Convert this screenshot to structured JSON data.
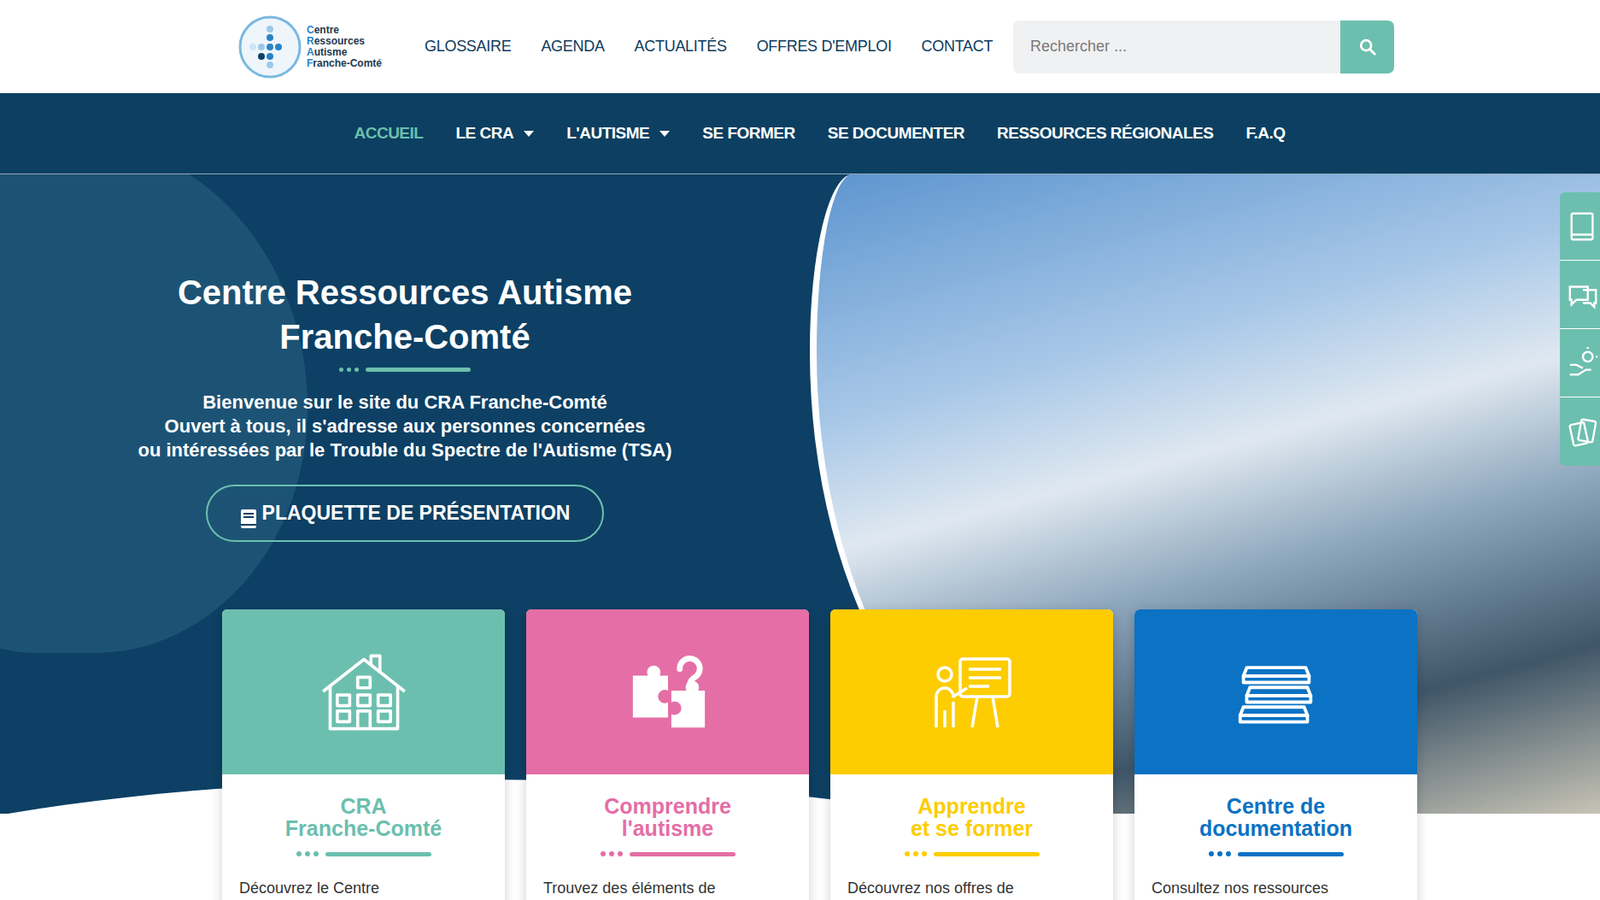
{
  "logo": {
    "lines": [
      "Centre",
      "Ressources",
      "Autisme",
      "Franche-Comté"
    ]
  },
  "top_nav": [
    "GLOSSAIRE",
    "AGENDA",
    "ACTUALITÉS",
    "OFFRES D'EMPLOI",
    "CONTACT"
  ],
  "search": {
    "placeholder": "Rechercher ..."
  },
  "main_nav": [
    {
      "label": "ACCUEIL",
      "selected": true,
      "dropdown": false
    },
    {
      "label": "LE CRA",
      "selected": false,
      "dropdown": true
    },
    {
      "label": "L'AUTISME",
      "selected": false,
      "dropdown": true
    },
    {
      "label": "SE FORMER",
      "selected": false,
      "dropdown": false
    },
    {
      "label": "SE DOCUMENTER",
      "selected": false,
      "dropdown": false
    },
    {
      "label": "RESSOURCES RÉGIONALES",
      "selected": false,
      "dropdown": false
    },
    {
      "label": "F.A.Q",
      "selected": false,
      "dropdown": false
    }
  ],
  "hero": {
    "title_lines": [
      "Centre Ressources Autisme",
      "Franche-Comté"
    ],
    "intro_lines": [
      "Bienvenue sur le site du CRA Franche-Comté",
      "Ouvert à tous, il s'adresse aux personnes concernées",
      "ou intéressées par le Trouble du Spectre de l'Autisme (TSA)"
    ],
    "button": "PLAQUETTE DE PRÉSENTATION"
  },
  "cards": [
    {
      "kind": "house",
      "title_lines": [
        "CRA",
        "Franche-Comté"
      ],
      "text": "Découvrez le Centre",
      "color": "#6cbfae"
    },
    {
      "kind": "puzzle",
      "title_lines": [
        "Comprendre",
        "l'autisme"
      ],
      "text": "Trouvez des éléments de",
      "color": "#e46ea5"
    },
    {
      "kind": "teacher",
      "title_lines": [
        "Apprendre",
        "et se former"
      ],
      "text": "Découvrez nos offres de",
      "color": "#fdcd01"
    },
    {
      "kind": "books",
      "title_lines": [
        "Centre de",
        "documentation"
      ],
      "text": "Consultez nos ressources",
      "color": "#0b72c4"
    }
  ]
}
